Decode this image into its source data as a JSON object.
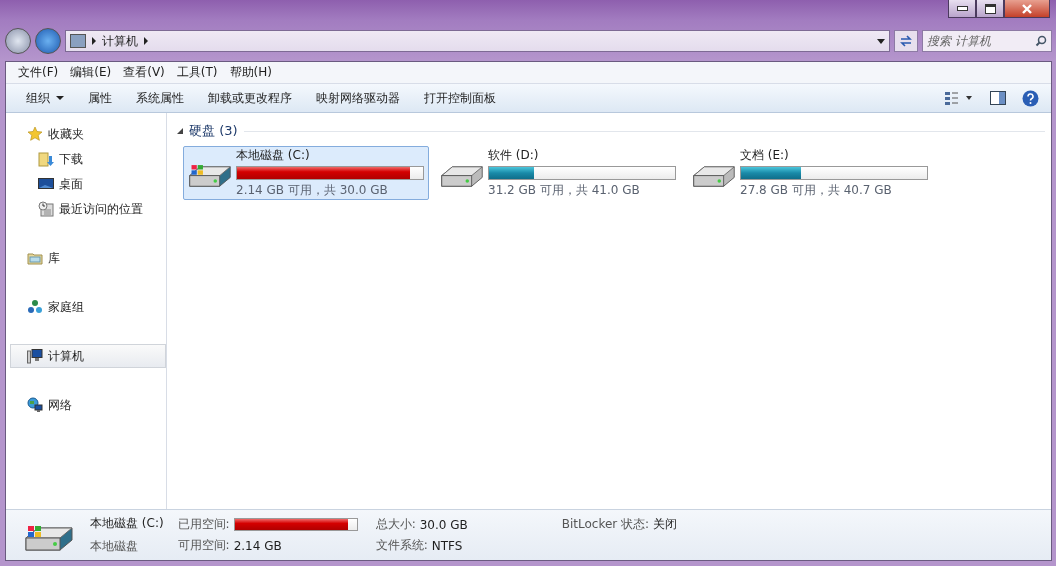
{
  "address": {
    "crumbs": [
      "计算机"
    ],
    "search_placeholder": "搜索 计算机"
  },
  "menu": [
    "文件(F)",
    "编辑(E)",
    "查看(V)",
    "工具(T)",
    "帮助(H)"
  ],
  "toolbar": [
    {
      "label": "组织",
      "kind": "dropdown"
    },
    {
      "label": "属性",
      "kind": "plain"
    },
    {
      "label": "系统属性",
      "kind": "plain"
    },
    {
      "label": "卸载或更改程序",
      "kind": "plain"
    },
    {
      "label": "映射网络驱动器",
      "kind": "plain"
    },
    {
      "label": "打开控制面板",
      "kind": "plain"
    }
  ],
  "sidebar": [
    {
      "label": "收藏夹",
      "kind": "favorites",
      "selected": false,
      "children": [
        {
          "label": "下载",
          "kind": "downloads",
          "selected": false
        },
        {
          "label": "桌面",
          "kind": "desktop",
          "selected": false
        },
        {
          "label": "最近访问的位置",
          "kind": "recent",
          "selected": false
        }
      ]
    },
    {
      "label": "库",
      "kind": "library",
      "selected": false
    },
    {
      "label": "家庭组",
      "kind": "homegroup",
      "selected": false
    },
    {
      "label": "计算机",
      "kind": "computer",
      "selected": true
    },
    {
      "label": "网络",
      "kind": "network",
      "selected": false
    }
  ],
  "group": {
    "title": "硬盘 (3)",
    "expanded": true
  },
  "drives": [
    {
      "name": "本地磁盘 (C:)",
      "kind": "system",
      "level": 0.93,
      "full": true,
      "free_text": "2.14 GB 可用，共 30.0 GB",
      "selected": true
    },
    {
      "name": "软件 (D:)",
      "kind": "plain",
      "level": 0.24,
      "full": false,
      "free_text": "31.2 GB 可用，共 41.0 GB",
      "selected": false
    },
    {
      "name": "文档 (E:)",
      "kind": "plain",
      "level": 0.32,
      "full": false,
      "free_text": "27.8 GB 可用，共 40.7 GB",
      "selected": false
    }
  ],
  "details": {
    "name": "本地磁盘 (C:)",
    "type": "本地磁盘",
    "used": {
      "label": "已用空间:",
      "level": 0.93
    },
    "free_label": "可用空间:",
    "free_value": "2.14 GB",
    "total_label": "总大小:",
    "total_value": "30.0 GB",
    "fs_label": "文件系统:",
    "fs_value": "NTFS",
    "bitlocker_label": "BitLocker 状态:",
    "bitlocker_value": "关闭"
  }
}
